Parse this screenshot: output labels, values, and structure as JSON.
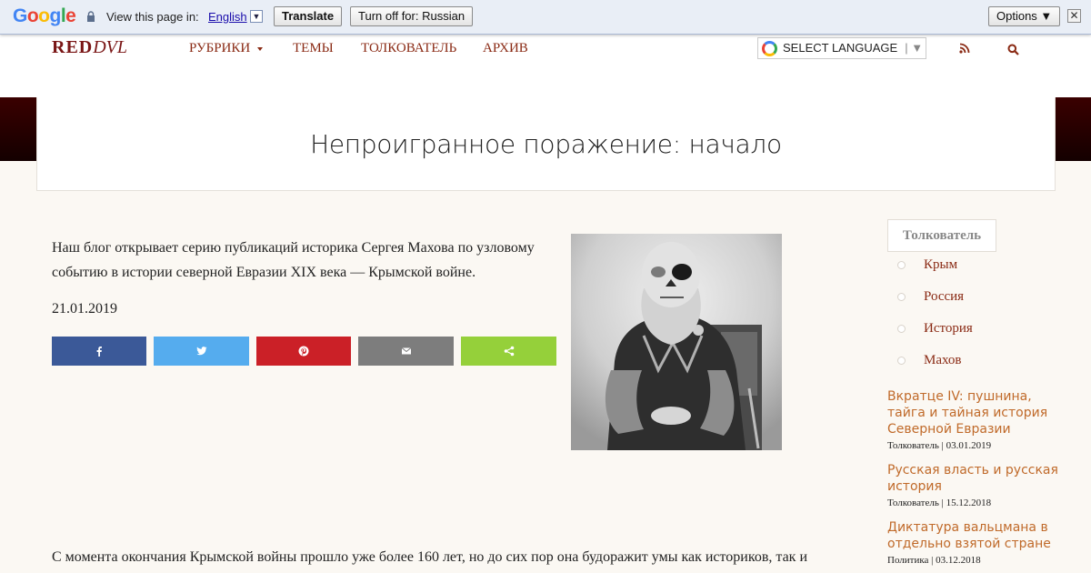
{
  "translate_bar": {
    "logo": "Google",
    "view_text": "View this page in:",
    "language": "English",
    "translate_button": "Translate",
    "turn_off_button": "Turn off for: Russian",
    "options_button": "Options ▼",
    "close": "✕",
    "arrow": "▼"
  },
  "header": {
    "logo_main": "RED",
    "logo_alt": "DVL",
    "nav": [
      "РУБРИКИ",
      "ТЕМЫ",
      "ТОЛКОВАТЕЛЬ",
      "АРХИВ"
    ],
    "select_language": "SELECT LANGUAGE",
    "select_arrow": "▼"
  },
  "article": {
    "title": "Непроигранное поражение: начало",
    "lead": "Наш блог открывает серию публикаций историка Сергея Махова по узловому событию в истории северной Евразии XIX века — Крымской войне.",
    "date": "21.01.2019",
    "body_start": "С момента окончания Крымской войны прошло уже более 160 лет, но до сих пор она будоражит умы как историков, так и"
  },
  "share": {
    "colors": {
      "facebook": "#3b5998",
      "twitter": "#55acee",
      "pinterest": "#cb2027",
      "email": "#7d7d7d",
      "sharethis": "#95d03a"
    },
    "icons": [
      "facebook-icon",
      "twitter-icon",
      "pinterest-icon",
      "email-icon",
      "share-icon"
    ]
  },
  "sidebar": {
    "tag_heading": "Толкователь",
    "tags": [
      "Крым",
      "Россия",
      "История",
      "Махов"
    ],
    "posts": [
      {
        "title": "Вкратце IV: пушнина, тайга и тайная история Северной Евразии",
        "meta": "Толкователь | 03.01.2019"
      },
      {
        "title": "Русская власть и русская история",
        "meta": "Толкователь | 15.12.2018"
      },
      {
        "title": "Диктатура вальцмана в отдельно взятой стране",
        "meta": "Политика | 03.12.2018"
      }
    ]
  },
  "colors": {
    "accent_nav": "#8a2a14",
    "accent_posts": "#c06a2a",
    "banner_dark": "#2a0000"
  }
}
